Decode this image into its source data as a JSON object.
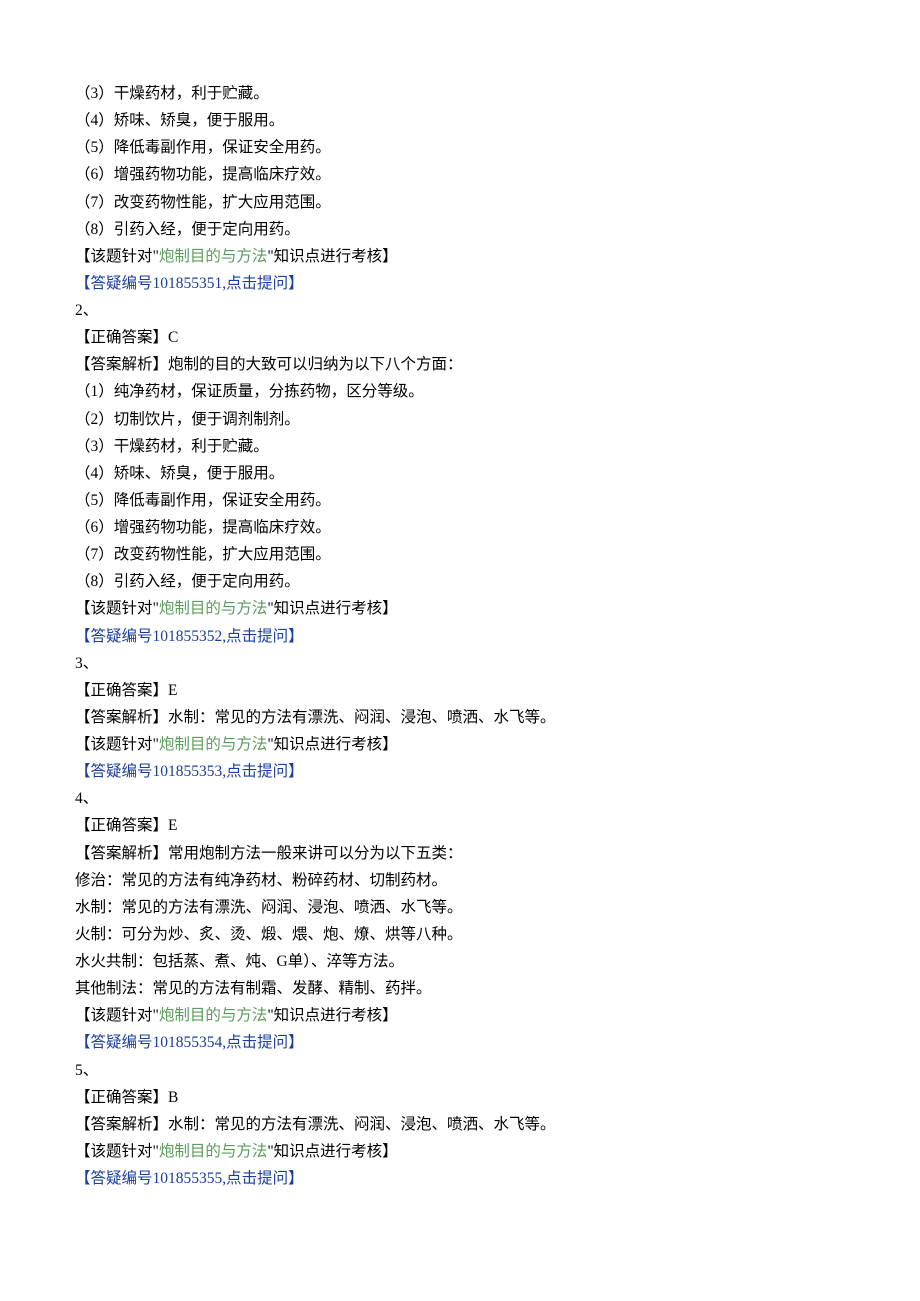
{
  "q1": {
    "p3": "（3）干燥药材，利于贮藏。",
    "p4": "（4）矫味、矫臭，便于服用。",
    "p5": "（5）降低毒副作用，保证安全用药。",
    "p6": "（6）增强药物功能，提高临床疗效。",
    "p7": "（7）改变药物性能，扩大应用范围。",
    "p8": "（8）引药入经，便于定向用药。",
    "note_pre": "【该题针对\"",
    "note_topic": "炮制目的与方法",
    "note_post": "\"知识点进行考核】",
    "link": "【答疑编号101855351,点击提问】"
  },
  "q2": {
    "num": "2、",
    "ans": "【正确答案】C",
    "intro": "【答案解析】炮制的目的大致可以归纳为以下八个方面：",
    "p1": "（1）纯净药材，保证质量，分拣药物，区分等级。",
    "p2": "（2）切制饮片，便于调剂制剂。",
    "p3": "（3）干燥药材，利于贮藏。",
    "p4": "（4）矫味、矫臭，便于服用。",
    "p5": "（5）降低毒副作用，保证安全用药。",
    "p6": "（6）增强药物功能，提高临床疗效。",
    "p7": "（7）改变药物性能，扩大应用范围。",
    "p8": "（8）引药入经，便于定向用药。",
    "note_pre": "【该题针对\"",
    "note_topic": "炮制目的与方法",
    "note_post": "\"知识点进行考核】",
    "link": "【答疑编号101855352,点击提问】"
  },
  "q3": {
    "num": "3、",
    "ans": "【正确答案】E",
    "expl": "【答案解析】水制：常见的方法有漂洗、闷润、浸泡、喷洒、水飞等。",
    "note_pre": "【该题针对\"",
    "note_topic": "炮制目的与方法",
    "note_post": "\"知识点进行考核】",
    "link": "【答疑编号101855353,点击提问】"
  },
  "q4": {
    "num": "4、",
    "ans": "【正确答案】E",
    "intro": "【答案解析】常用炮制方法一般来讲可以分为以下五类：",
    "l1": "修治：常见的方法有纯净药材、粉碎药材、切制药材。",
    "l2": "水制：常见的方法有漂洗、闷润、浸泡、喷洒、水飞等。",
    "l3": "火制：可分为炒、炙、烫、煅、煨、炮、燎、烘等八种。",
    "l4": "水火共制：包括蒸、煮、炖、G单）、淬等方法。",
    "l5": "其他制法：常见的方法有制霜、发酵、精制、药拌。",
    "note_pre": "【该题针对\"",
    "note_topic": "炮制目的与方法",
    "note_post": "\"知识点进行考核】",
    "link": "【答疑编号101855354,点击提问】"
  },
  "q5": {
    "num": "5、",
    "ans": "【正确答案】B",
    "expl": "【答案解析】水制：常见的方法有漂洗、闷润、浸泡、喷洒、水飞等。",
    "note_pre": "【该题针对\"",
    "note_topic": "炮制目的与方法",
    "note_post": "\"知识点进行考核】",
    "link": "【答疑编号101855355,点击提问】"
  }
}
